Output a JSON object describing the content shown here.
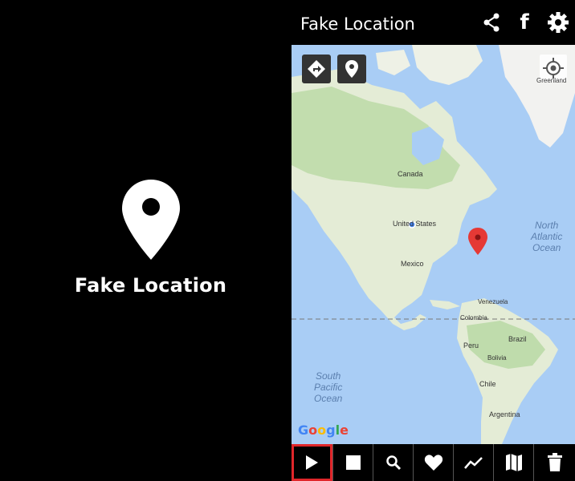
{
  "splash": {
    "title": "Fake Location"
  },
  "appbar": {
    "title": "Fake Location",
    "icons": [
      "share-icon",
      "facebook-icon",
      "settings-icon"
    ],
    "facebook_glyph": "f"
  },
  "map": {
    "labels": {
      "canada": "Canada",
      "united_states": "United States",
      "mexico": "Mexico",
      "venezuela": "Venezuela",
      "colombia": "Colombia",
      "peru": "Peru",
      "brazil": "Brazil",
      "bolivia": "Bolivia",
      "chile": "Chile",
      "argentina": "Argentina",
      "greenland": "Greenland"
    },
    "oceans": {
      "north_atlantic": "North\nAtlantic\nOcean",
      "south_pacific": "South\nPacific\nOcean"
    },
    "attribution": "Google"
  },
  "colors": {
    "water": "#a9cdf5",
    "land": "#e4ecd6",
    "forest": "#b9d9a4",
    "marker": "#e53935",
    "highlight": "#e0262a",
    "dot": "#4285f4"
  },
  "toolbar": {
    "icons": [
      "play-icon",
      "stop-icon",
      "search-icon",
      "heart-icon",
      "route-icon",
      "map-icon",
      "trash-icon"
    ]
  }
}
